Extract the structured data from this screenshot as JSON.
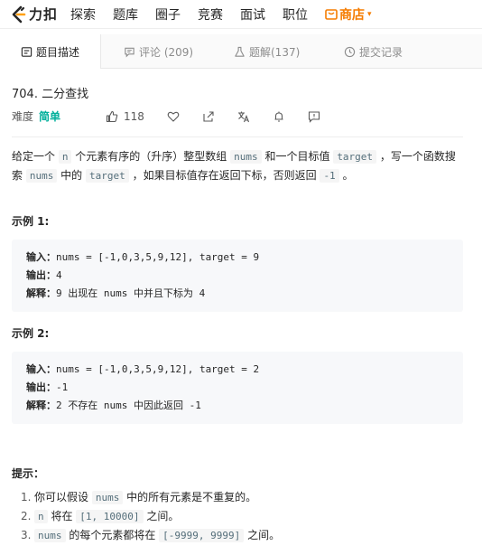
{
  "topnav": {
    "logo_text": "力扣",
    "items": [
      "探索",
      "题库",
      "圈子",
      "竞赛",
      "面试",
      "职位"
    ],
    "store_label": "商店",
    "store_caret": "▾"
  },
  "tabs": [
    {
      "label": "题目描述",
      "icon": "description-icon"
    },
    {
      "label": "评论 (209)",
      "icon": "comment-icon"
    },
    {
      "label": "题解(137)",
      "icon": "flask-icon"
    },
    {
      "label": "提交记录",
      "icon": "clock-icon"
    }
  ],
  "problem": {
    "title": "704. 二分查找",
    "difficulty_label": "难度",
    "difficulty": "简单",
    "likes": "118"
  },
  "description": {
    "p1": "给定一个",
    "c1": "n",
    "p2": "个元素有序的（升序）整型数组",
    "c2": "nums",
    "p3": "和一个目标值",
    "c3": "target",
    "p4": "，写一个函数搜索",
    "c4": "nums",
    "p5": "中的",
    "c5": "target",
    "p6": "，如果目标值存在返回下标，否则返回",
    "c6": "-1",
    "p7": "。"
  },
  "examples": [
    {
      "heading": "示例 1:",
      "input_label": "输入：",
      "input": "nums = [-1,0,3,5,9,12], target = 9",
      "output_label": "输出：",
      "output": "4",
      "explain_label": "解释：",
      "explain": "9 出现在 nums 中并且下标为 4"
    },
    {
      "heading": "示例 2:",
      "input_label": "输入：",
      "input": "nums = [-1,0,3,5,9,12], target = 2",
      "output_label": "输出：",
      "output": "-1",
      "explain_label": "解释：",
      "explain": "2 不存在 nums 中因此返回 -1"
    }
  ],
  "hints": {
    "title": "提示：",
    "items": [
      {
        "num": "1.",
        "a": "你可以假设",
        "code": "nums",
        "b": "中的所有元素是不重复的。"
      },
      {
        "num": "2.",
        "code1": "n",
        "a": "将在",
        "code2": "[1, 10000]",
        "b": "之间。"
      },
      {
        "num": "3.",
        "code1": "nums",
        "a": "的每个元素都将在",
        "code2": "[-9999, 9999]",
        "b": "之间。"
      }
    ]
  }
}
